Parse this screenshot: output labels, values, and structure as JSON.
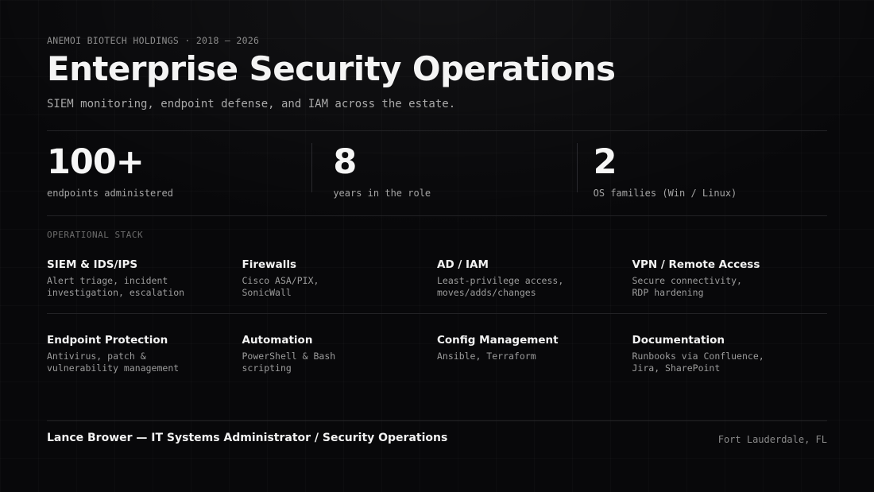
{
  "header": {
    "eyebrow": "ANEMOI BIOTECH HOLDINGS · 2018 – 2026",
    "title": "Enterprise Security Operations",
    "subtitle": "SIEM monitoring, endpoint defense, and IAM across the estate."
  },
  "stats": [
    {
      "value": "100+",
      "label": "endpoints administered"
    },
    {
      "value": "8",
      "label": "years in the role"
    },
    {
      "value": "2",
      "label": "OS families (Win / Linux)"
    }
  ],
  "stack": {
    "label": "OPERATIONAL STACK",
    "items": [
      {
        "title": "SIEM & IDS/IPS",
        "desc": "Alert triage, incident\ninvestigation, escalation"
      },
      {
        "title": "Firewalls",
        "desc": "Cisco ASA/PIX,\nSonicWall"
      },
      {
        "title": "AD / IAM",
        "desc": "Least-privilege access,\nmoves/adds/changes"
      },
      {
        "title": "VPN / Remote Access",
        "desc": "Secure connectivity,\nRDP hardening"
      },
      {
        "title": "Endpoint Protection",
        "desc": "Antivirus, patch &\nvulnerability management"
      },
      {
        "title": "Automation",
        "desc": "PowerShell & Bash\nscripting"
      },
      {
        "title": "Config Management",
        "desc": "Ansible, Terraform"
      },
      {
        "title": "Documentation",
        "desc": "Runbooks via Confluence,\nJira, SharePoint"
      }
    ]
  },
  "footer": {
    "name": "Lance Brower — IT Systems Administrator / Security Operations",
    "location": "Fort Lauderdale, FL"
  },
  "colors": {
    "background": "#09090a",
    "text_primary": "#f2f2f2",
    "text_muted": "#9c9c9c",
    "divider": "#222225"
  }
}
